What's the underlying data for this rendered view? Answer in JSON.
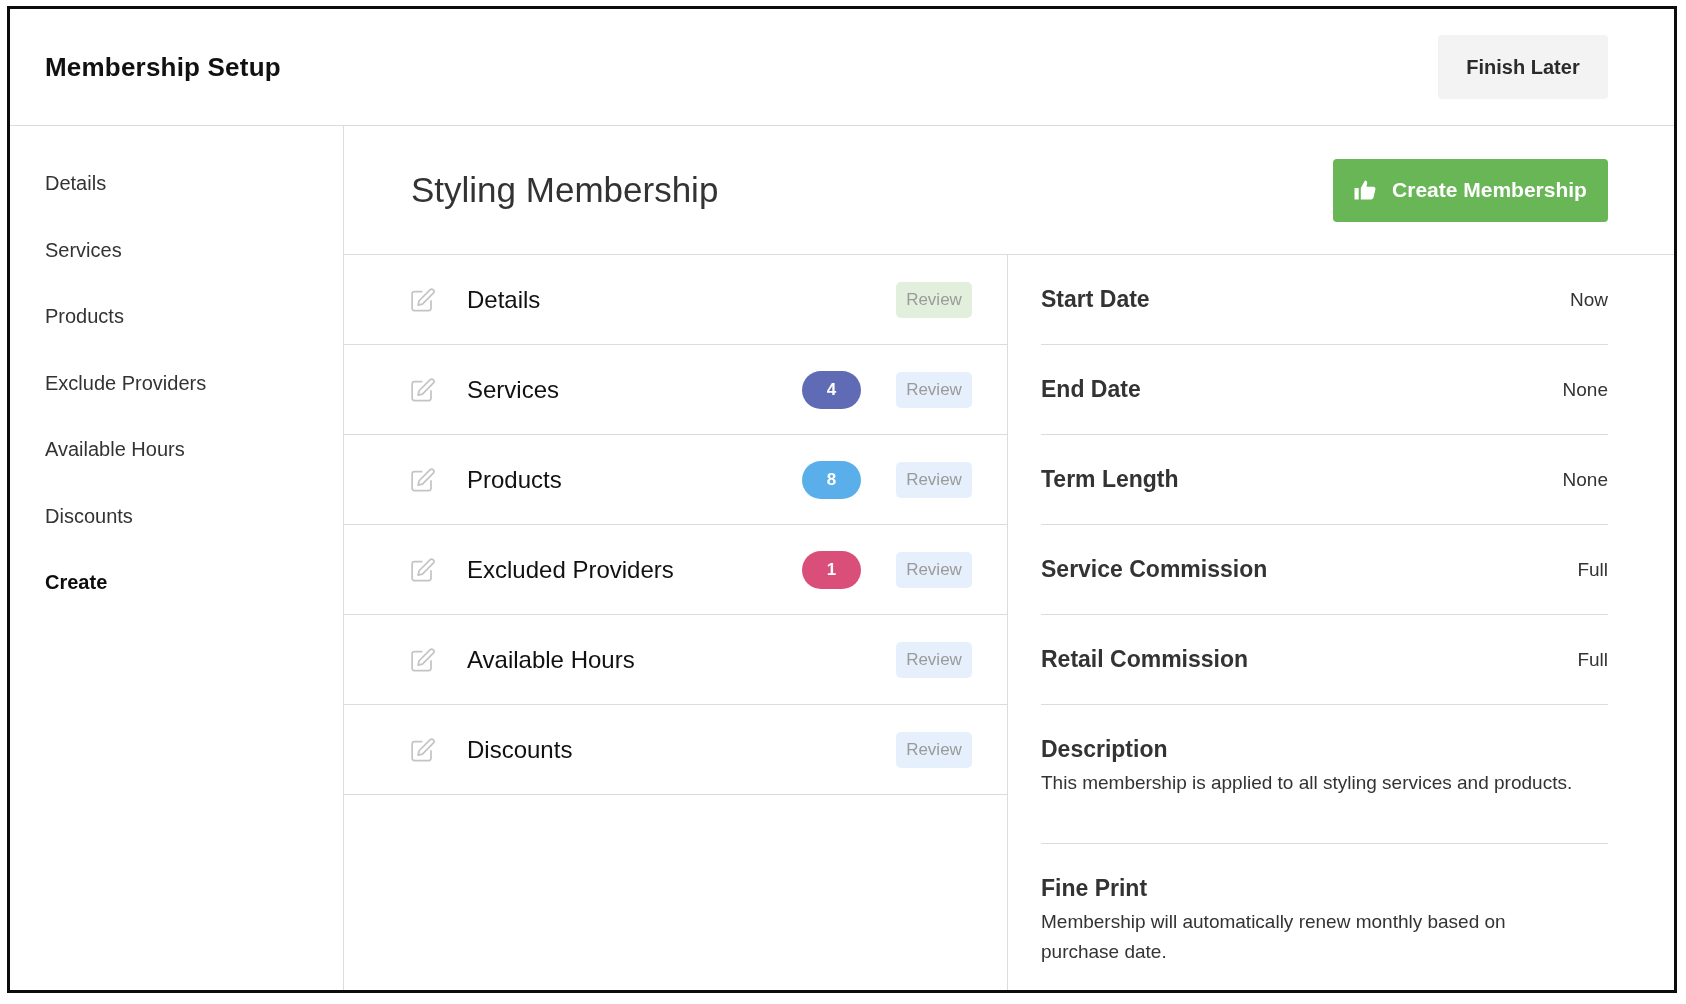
{
  "header": {
    "title": "Membership Setup",
    "finish_button": "Finish Later"
  },
  "sidebar": {
    "items": [
      {
        "label": "Details",
        "selected": false
      },
      {
        "label": "Services",
        "selected": false
      },
      {
        "label": "Products",
        "selected": false
      },
      {
        "label": "Exclude Providers",
        "selected": false
      },
      {
        "label": "Available Hours",
        "selected": false
      },
      {
        "label": "Discounts",
        "selected": false
      },
      {
        "label": "Create",
        "selected": true
      }
    ]
  },
  "main": {
    "title": "Styling Membership",
    "create_button": "Create Membership"
  },
  "sections": [
    {
      "label": "Details",
      "review": {
        "label": "Review",
        "color": "#e2efdc"
      }
    },
    {
      "label": "Services",
      "badge": {
        "count": "4",
        "color": "#5f6bb4"
      },
      "review": {
        "label": "Review",
        "color": "#e6f0fc"
      }
    },
    {
      "label": "Products",
      "badge": {
        "count": "8",
        "color": "#5aaeea"
      },
      "review": {
        "label": "Review",
        "color": "#e6f0fc"
      }
    },
    {
      "label": "Excluded Providers",
      "badge": {
        "count": "1",
        "color": "#da4f79"
      },
      "review": {
        "label": "Review",
        "color": "#e6f0fc"
      }
    },
    {
      "label": "Available Hours",
      "review": {
        "label": "Review",
        "color": "#e6f0fc"
      }
    },
    {
      "label": "Discounts",
      "review": {
        "label": "Review",
        "color": "#e6f0fc"
      }
    }
  ],
  "summary": {
    "fields": [
      {
        "label": "Start Date",
        "value": "Now"
      },
      {
        "label": "End Date",
        "value": "None"
      },
      {
        "label": "Term Length",
        "value": "None"
      },
      {
        "label": "Service Commission",
        "value": "Full"
      },
      {
        "label": "Retail Commission",
        "value": "Full"
      }
    ],
    "notes": [
      {
        "title": "Description",
        "text": "This membership is applied to all styling services and products."
      },
      {
        "title": "Fine Print",
        "text": "Membership will automatically renew monthly based on purchase date."
      }
    ]
  }
}
